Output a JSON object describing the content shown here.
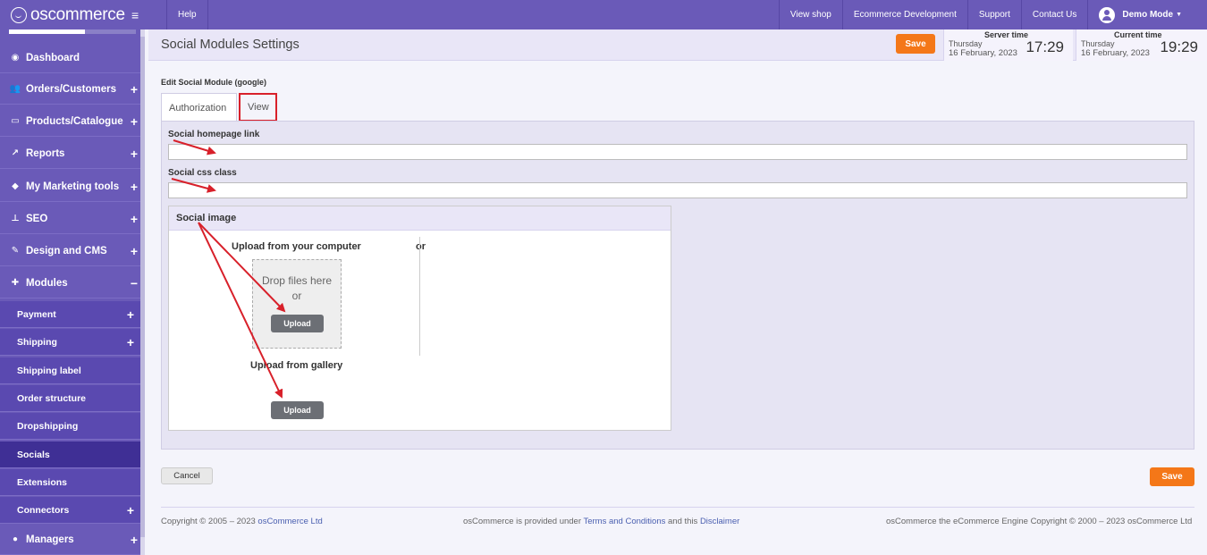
{
  "topbar": {
    "logo": "oscommerce",
    "menu_icon": "hamburger-icon",
    "help": "Help",
    "links": [
      "View shop",
      "Ecommerce Development",
      "Support",
      "Contact Us"
    ],
    "user": "Demo Mode"
  },
  "sidebar": {
    "main_items": [
      {
        "label": "Dashboard",
        "icon": "dashboard-icon",
        "expand": ""
      },
      {
        "label": "Orders/Customers",
        "icon": "users-icon",
        "expand": "+"
      },
      {
        "label": "Products/Catalogue",
        "icon": "folder-icon",
        "expand": "+"
      },
      {
        "label": "Reports",
        "icon": "chart-icon",
        "expand": "+"
      },
      {
        "label": "My Marketing tools",
        "icon": "tag-icon",
        "expand": "+"
      },
      {
        "label": "SEO",
        "icon": "sitemap-icon",
        "expand": "+"
      },
      {
        "label": "Design and CMS",
        "icon": "brush-icon",
        "expand": "+"
      },
      {
        "label": "Modules",
        "icon": "puzzle-icon",
        "expand": "−"
      }
    ],
    "sub_items": [
      {
        "label": "Payment",
        "expand": "+"
      },
      {
        "label": "Shipping",
        "expand": "+"
      },
      {
        "label": "Shipping label",
        "expand": ""
      },
      {
        "label": "Order structure",
        "expand": ""
      },
      {
        "label": "Dropshipping",
        "expand": ""
      },
      {
        "label": "Socials",
        "expand": ""
      },
      {
        "label": "Extensions",
        "expand": ""
      },
      {
        "label": "Connectors",
        "expand": "+"
      }
    ],
    "bottom_item": {
      "label": "Managers",
      "icon": "user-icon",
      "expand": "+"
    }
  },
  "header": {
    "title": "Social Modules Settings",
    "save": "Save",
    "server_time": {
      "label": "Server time",
      "day": "Thursday",
      "date": "16 February, 2023",
      "time": "17:29"
    },
    "current_time": {
      "label": "Current time",
      "day": "Thursday",
      "date": "16 February, 2023",
      "time": "19:29"
    }
  },
  "form": {
    "edit_label": "Edit Social Module (google)",
    "tabs": [
      "Authorization",
      "View"
    ],
    "homepage_label": "Social homepage link",
    "homepage_value": "",
    "css_label": "Social css class",
    "css_value": "",
    "image": {
      "title": "Social image",
      "upload_computer": "Upload from your computer",
      "or": "or",
      "drop_text": "Drop files here",
      "drop_or": "or",
      "upload_btn": "Upload",
      "upload_gallery": "Upload from gallery",
      "gallery_btn": "Upload"
    },
    "cancel": "Cancel",
    "save": "Save"
  },
  "footer": {
    "copyright_prefix": "Copyright © 2005 – 2023 ",
    "copyright_link": "osCommerce Ltd",
    "middle_a": "osCommerce is provided under ",
    "terms": "Terms and Conditions",
    "middle_b": " and this ",
    "disclaimer": "Disclaimer",
    "right": "osCommerce the eCommerce Engine Copyright © 2000 – 2023 osCommerce Ltd"
  },
  "colors": {
    "brand": "#6a5ab8",
    "accent": "#f47718",
    "annotation": "#d8202a"
  }
}
